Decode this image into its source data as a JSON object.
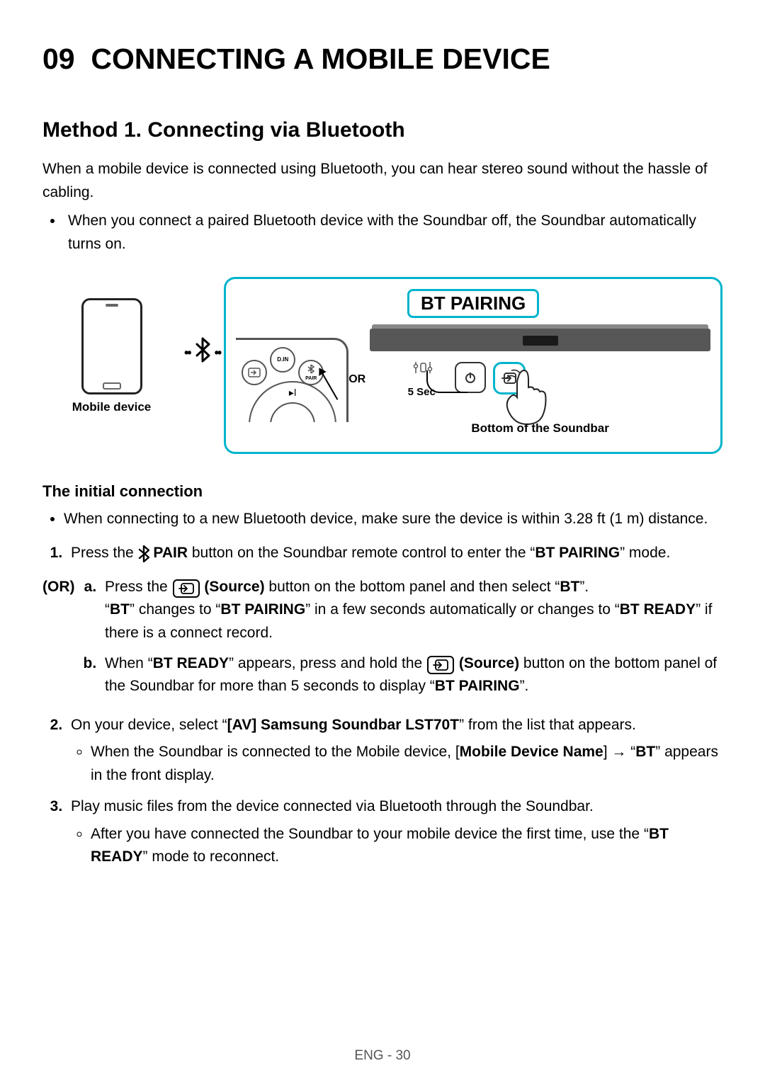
{
  "section_number": "09",
  "title": "CONNECTING A MOBILE DEVICE",
  "method_heading": "Method 1. Connecting via Bluetooth",
  "intro": "When a mobile device is connected using Bluetooth, you can hear stereo sound without the hassle of cabling.",
  "intro_bullet": "When you connect a paired Bluetooth device with the Soundbar off, the Soundbar automatically turns on.",
  "diagram": {
    "mobile_label": "Mobile device",
    "bt_pairing": "BT PAIRING",
    "or": "OR",
    "five_sec": "5 Sec",
    "bottom_label": "Bottom of the Soundbar",
    "remote": {
      "din": "D.IN",
      "pair": "PAIR"
    }
  },
  "initial_heading": "The initial connection",
  "initial_bullet": "When connecting to a new Bluetooth device, make sure the device is within 3.28 ft (1 m) distance.",
  "step1": {
    "pre": "Press the ",
    "pair_strong": "PAIR",
    "post1": " button on the Soundbar remote control to enter the “",
    "bt_pairing": "BT PAIRING",
    "post2": "” mode."
  },
  "or_label": "(OR)",
  "step_a": {
    "pre": "Press the ",
    "source": "(Source)",
    "mid": " button on the bottom panel and then select “",
    "bt": "BT",
    "post": "”.",
    "line2_q1o": "“",
    "line2_bt": "BT",
    "line2_mid1": "” changes to “",
    "line2_btp": "BT PAIRING",
    "line2_mid2": "” in a few seconds automatically or changes to “",
    "line2_btr": "BT READY",
    "line2_post": "” if there is a connect record."
  },
  "step_b": {
    "pre": "When “",
    "btr": "BT READY",
    "mid1": "” appears, press and hold the ",
    "source": "(Source)",
    "mid2": " button on the bottom panel of the Soundbar for more than 5 seconds to display “",
    "btp": "BT PAIRING",
    "post": "”."
  },
  "step2": {
    "pre": "On your device, select “",
    "device": "[AV] Samsung Soundbar LST70T",
    "post": "” from the list that appears.",
    "bullet_pre": "When the Soundbar is connected to the Mobile device, [",
    "mdn": "Mobile Device Name",
    "bullet_mid": "] → “",
    "bt": "BT",
    "bullet_post": "” appears in the front display."
  },
  "step3": {
    "text": "Play music files from the device connected via Bluetooth through the Soundbar.",
    "bullet_pre": "After you have connected the Soundbar to your mobile device the first time, use the “",
    "btr": "BT READY",
    "bullet_post": "” mode to reconnect."
  },
  "footer": "ENG - 30"
}
